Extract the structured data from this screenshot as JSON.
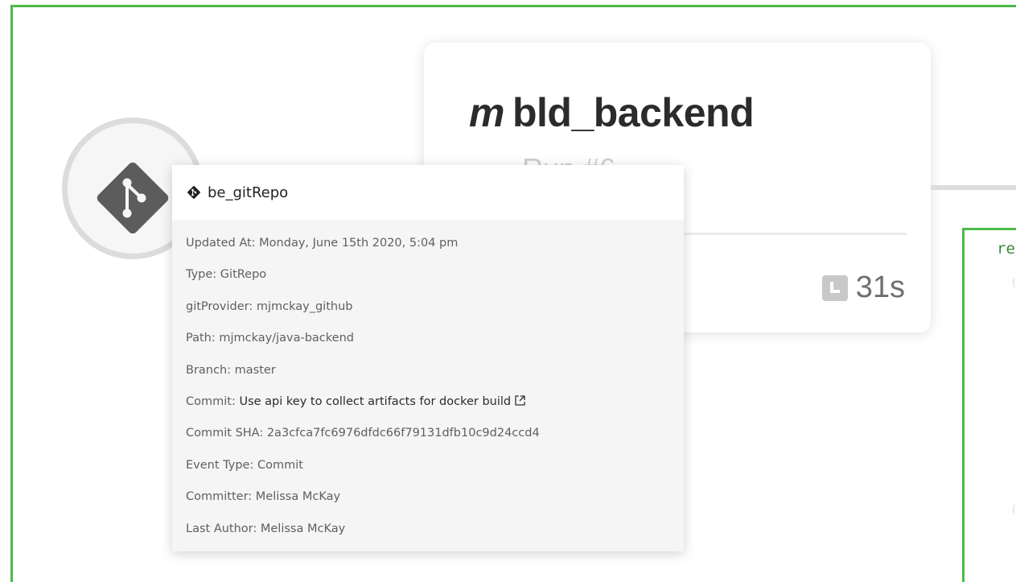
{
  "pipeline": {
    "title_glyph": "m",
    "title": "bld_backend",
    "run_label": "Run #6",
    "duration": "31s"
  },
  "next_step": {
    "label_fragment": "re"
  },
  "tooltip": {
    "repo_name": "be_gitRepo",
    "rows": {
      "updated_at": "Updated At: Monday, June 15th 2020, 5:04 pm",
      "type": "Type: GitRepo",
      "git_provider": "gitProvider: mjmckay_github",
      "path": "Path: mjmckay/java-backend",
      "branch": "Branch: master",
      "commit_prefix": "Commit: ",
      "commit_message": "Use api key to collect artifacts for docker build",
      "commit_sha": "Commit SHA: 2a3cfca7fc6976dfdc66f79131dfb10c9d24ccd4",
      "event_type": "Event Type: Commit",
      "committer": "Committer: Melissa McKay",
      "last_author": "Last Author: Melissa McKay"
    }
  },
  "colors": {
    "selection_border": "#4cba4a",
    "tooltip_bg": "#f5f5f5",
    "git_icon": "#5c5c5c"
  },
  "icons": {
    "resource_node": "git-icon",
    "tooltip_header": "git-icon",
    "duration": "clock-icon",
    "commit_link": "external-link-icon"
  }
}
